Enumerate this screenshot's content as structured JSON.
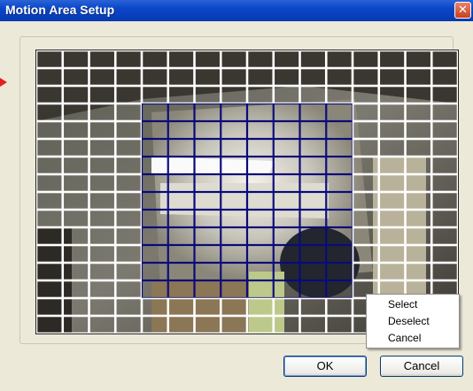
{
  "window": {
    "title": "Motion Area Setup",
    "close_icon": "close-icon",
    "title_color": "#0a46c8"
  },
  "motion_grid": {
    "columns": 16,
    "rows": 16,
    "unselected_line_color": "#ffffff",
    "selected_line_color": "#0a0a7a",
    "selected_region": {
      "col_start": 4,
      "col_end": 12,
      "row_start": 3,
      "row_end": 14
    }
  },
  "context_menu": {
    "items": [
      {
        "label": "Select"
      },
      {
        "label": "Deselect"
      },
      {
        "label": "Cancel"
      }
    ]
  },
  "buttons": {
    "ok_label": "OK",
    "cancel_label": "Cancel"
  }
}
